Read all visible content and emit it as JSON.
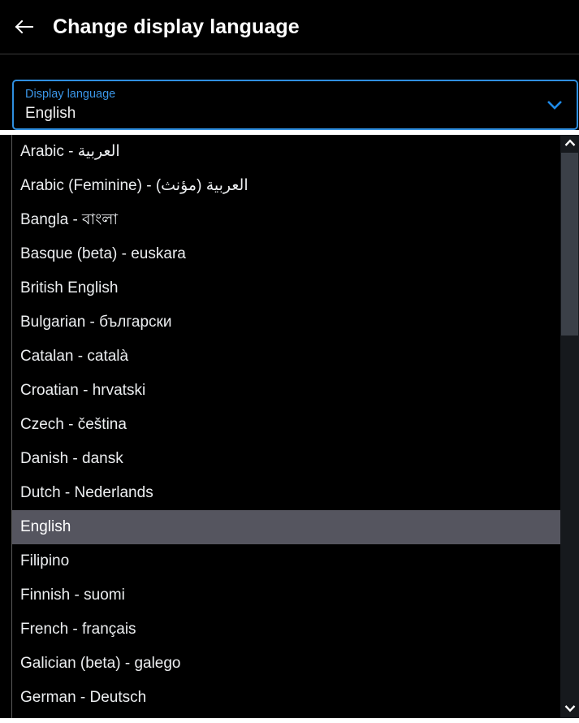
{
  "header": {
    "back_icon": "arrow-left-icon",
    "title": "Change display language"
  },
  "field": {
    "label": "Display language",
    "value": "English",
    "chevron_icon": "chevron-down-icon",
    "accent_color": "#2f8fe0",
    "label_color": "#3b96e8"
  },
  "dropdown": {
    "selected_index": 11,
    "highlight_color": "#55555f",
    "options": [
      {
        "label": "Arabic - العربية"
      },
      {
        "label": "Arabic (Feminine) - العربية (مؤنث)"
      },
      {
        "label": "Bangla - বাংলা"
      },
      {
        "label": "Basque (beta) - euskara"
      },
      {
        "label": "British English"
      },
      {
        "label": "Bulgarian - български"
      },
      {
        "label": "Catalan - català"
      },
      {
        "label": "Croatian - hrvatski"
      },
      {
        "label": "Czech - čeština"
      },
      {
        "label": "Danish - dansk"
      },
      {
        "label": "Dutch - Nederlands"
      },
      {
        "label": "English"
      },
      {
        "label": "Filipino"
      },
      {
        "label": "Finnish - suomi"
      },
      {
        "label": "French - français"
      },
      {
        "label": "Galician (beta) - galego"
      },
      {
        "label": "German - Deutsch"
      }
    ],
    "scrollbar": {
      "up_icon": "chevron-up-icon",
      "down_icon": "chevron-down-icon",
      "thumb_color": "#3b4048",
      "track_color": "#16191d"
    }
  }
}
